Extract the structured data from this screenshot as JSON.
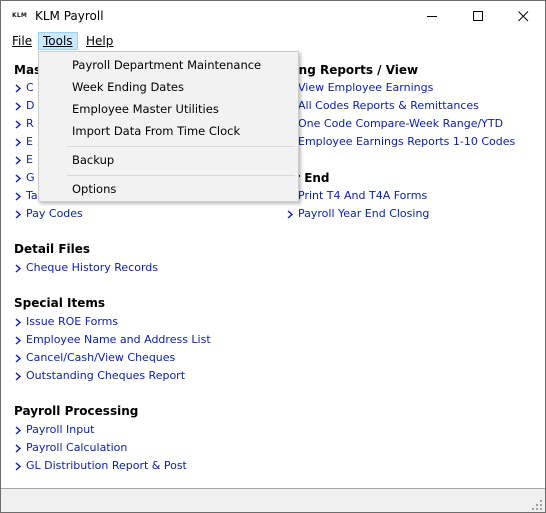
{
  "window": {
    "logo_text": "KLM",
    "title": "KLM Payroll"
  },
  "menubar": {
    "file": "File",
    "tools": "Tools",
    "help": "Help"
  },
  "tools_menu": {
    "items": [
      "Payroll Department Maintenance",
      "Week Ending Dates",
      "Employee Master Utilities",
      "Import Data From Time Clock",
      "Backup",
      "Options"
    ]
  },
  "sections": {
    "master_partial": "Mas",
    "master_links": [
      "C",
      "D",
      "R",
      "E",
      "E",
      "G",
      "Ta",
      "Pay Codes"
    ],
    "earnings_reports": {
      "title": "ning Reports / View",
      "links": [
        "View Employee Earnings",
        "All Codes Reports & Remittances",
        "One Code Compare-Week Range/YTD",
        "Employee Earnings Reports 1-10 Codes"
      ]
    },
    "year_end": {
      "title": "ar End",
      "links": [
        "Print T4 And T4A Forms",
        "Payroll Year End Closing"
      ]
    },
    "detail_files": {
      "title": "Detail Files",
      "links": [
        "Cheque History Records"
      ]
    },
    "special_items": {
      "title": "Special Items",
      "links": [
        "Issue ROE Forms",
        "Employee Name and Address List",
        "Cancel/Cash/View Cheques",
        "Outstanding Cheques Report"
      ]
    },
    "payroll_processing": {
      "title": "Payroll Processing",
      "links": [
        "Payroll Input",
        "Payroll Calculation",
        "GL Distribution Report & Post"
      ]
    }
  },
  "colors": {
    "link": "#0b1fa6",
    "menu_highlight": "#cce8ff"
  }
}
